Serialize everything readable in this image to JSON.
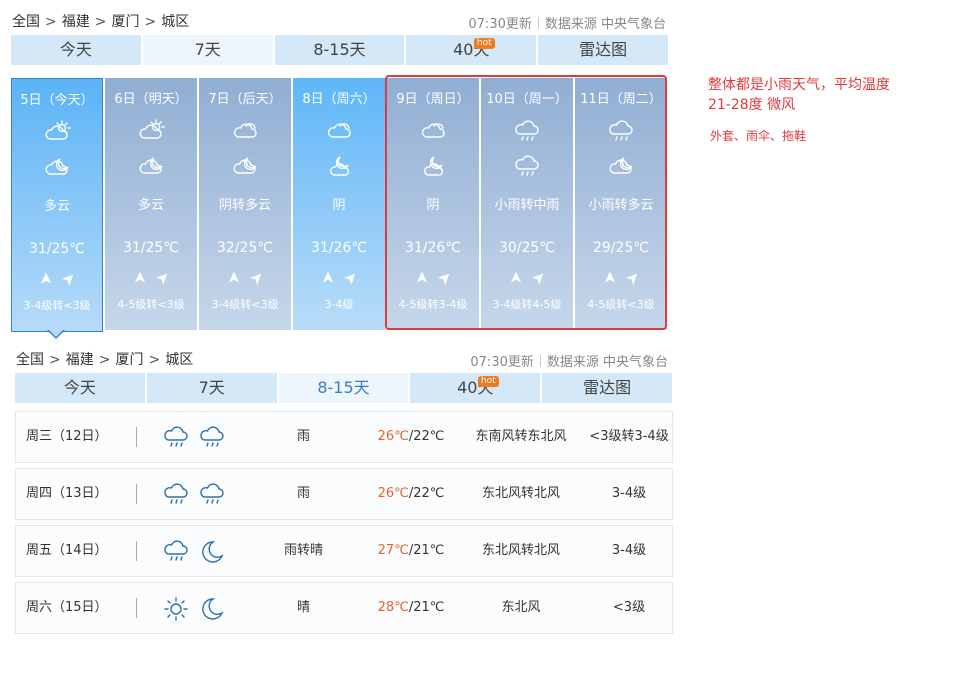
{
  "top": {
    "breadcrumb": [
      "全国",
      "福建",
      "厦门",
      "城区"
    ],
    "update": "07:30更新",
    "source": "数据来源 中央气象台",
    "tabs": [
      "今天",
      "7天",
      "8-15天",
      "40天",
      "雷达图"
    ],
    "hot": "hot"
  },
  "days": [
    {
      "date": "5日（今天）",
      "icon1": "partly-cloudy-sun-icon",
      "icon2": "cloud-moon-icon",
      "weather": "多云",
      "temp": "31/25℃",
      "arrows": "➤ ➤",
      "level": "3-4级转<3级"
    },
    {
      "date": "6日（明天）",
      "icon1": "partly-cloudy-sun-icon",
      "icon2": "cloud-moon-icon",
      "weather": "多云",
      "temp": "31/25℃",
      "arrows": "➤ ➤",
      "level": "4-5级转<3级"
    },
    {
      "date": "7日（后天）",
      "icon1": "cloud-icon",
      "icon2": "cloud-moon-icon",
      "weather": "阴转多云",
      "temp": "32/25℃",
      "arrows": "➤ ➤",
      "level": "3-4级转<3级"
    },
    {
      "date": "8日（周六）",
      "icon1": "cloud-icon",
      "icon2": "moon-cloud-icon",
      "weather": "阴",
      "temp": "31/26℃",
      "arrows": "➤ ➤",
      "level": "3-4级"
    },
    {
      "date": "9日（周日）",
      "icon1": "cloud-icon",
      "icon2": "moon-cloud-icon",
      "weather": "阴",
      "temp": "31/26℃",
      "arrows": "➤ ➤",
      "level": "4-5级转3-4级"
    },
    {
      "date": "10日（周一）",
      "icon1": "rain-cloud-icon",
      "icon2": "rain-cloud-icon",
      "weather": "小雨转中雨",
      "temp": "30/25℃",
      "arrows": "➤ ➤",
      "level": "3-4级转4-5级"
    },
    {
      "date": "11日（周二）",
      "icon1": "rain-cloud-icon",
      "icon2": "cloud-moon-icon",
      "weather": "小雨转多云",
      "temp": "29/25℃",
      "arrows": "➤ ➤",
      "level": "4-5级转<3级"
    }
  ],
  "note": {
    "line1": "整体都是小雨天气，平均温度",
    "line2": "21-28度 微风",
    "line3": "外套、雨伞、拖鞋"
  },
  "bottom": {
    "breadcrumb": [
      "全国",
      "福建",
      "厦门",
      "城区"
    ],
    "update": "07:30更新",
    "source": "数据来源 中央气象台",
    "tabs": [
      "今天",
      "7天",
      "8-15天",
      "40天",
      "雷达图"
    ],
    "hot": "hot"
  },
  "rows": [
    {
      "day": "周三（12日）",
      "icons": [
        "rain-cloud-icon",
        "rain-cloud-icon"
      ],
      "weather": "雨",
      "hi": "26℃",
      "lo": "/22℃",
      "wind": "东南风转东北风",
      "level": "<3级转3-4级"
    },
    {
      "day": "周四（13日）",
      "icons": [
        "rain-cloud-icon",
        "rain-cloud-icon"
      ],
      "weather": "雨",
      "hi": "26℃",
      "lo": "/22℃",
      "wind": "东北风转北风",
      "level": "3-4级"
    },
    {
      "day": "周五（14日）",
      "icons": [
        "rain-cloud-icon",
        "moon-icon"
      ],
      "weather": "雨转晴",
      "hi": "27℃",
      "lo": "/21℃",
      "wind": "东北风转北风",
      "level": "3-4级"
    },
    {
      "day": "周六（15日）",
      "icons": [
        "sun-icon",
        "moon-icon"
      ],
      "weather": "晴",
      "hi": "28℃",
      "lo": "/21℃",
      "wind": "东北风",
      "level": "<3级"
    }
  ]
}
